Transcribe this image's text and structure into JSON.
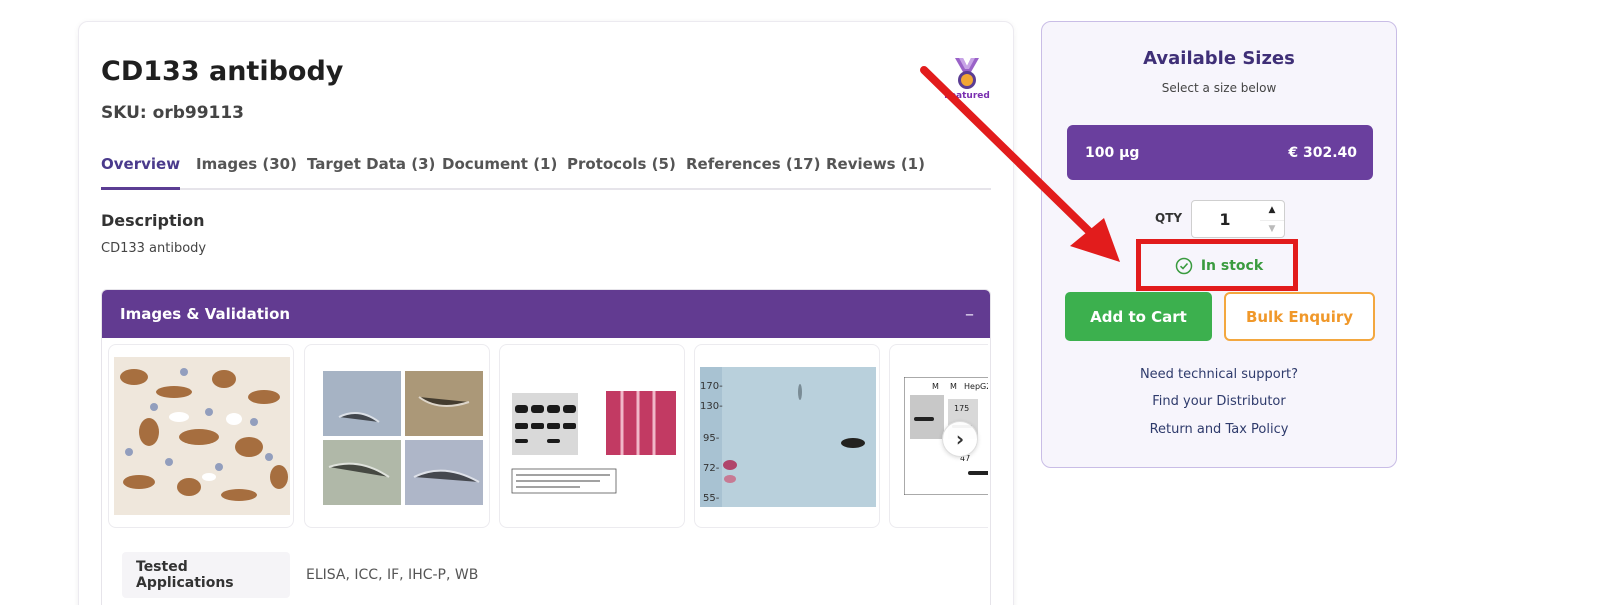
{
  "product": {
    "title": "CD133 antibody",
    "sku": "SKU: orb99113",
    "badge_label": "Featured"
  },
  "tabs": [
    {
      "label": "Overview",
      "active": true
    },
    {
      "label": "Images (30)",
      "active": false
    },
    {
      "label": "Target Data (3)",
      "active": false
    },
    {
      "label": "Document (1)",
      "active": false
    },
    {
      "label": "Protocols (5)",
      "active": false
    },
    {
      "label": "References (17)",
      "active": false
    },
    {
      "label": "Reviews (1)",
      "active": false
    }
  ],
  "description": {
    "heading": "Description",
    "text": "CD133 antibody"
  },
  "images_section": {
    "title": "Images & Validation",
    "toggle": "–",
    "next_icon": "chevron-right-icon"
  },
  "tested_applications": {
    "label": "Tested Applications",
    "value": "ELISA, ICC, IF, IHC-P, WB"
  },
  "sizes": {
    "title": "Available Sizes",
    "subtitle": "Select a size below",
    "option": {
      "size": "100 µg",
      "price": "€ 302.40"
    },
    "qty_label": "QTY",
    "qty_value": "1",
    "stock": "In stock",
    "add_to_cart": "Add to Cart",
    "bulk_enquiry": "Bulk Enquiry",
    "links": [
      "Need technical support?",
      "Find your Distributor",
      "Return and Tax Policy"
    ]
  },
  "colors": {
    "brand_purple": "#623b91",
    "stock_green": "#3a9b3f",
    "cart_green": "#3cb04e",
    "bulk_orange": "#f0982a",
    "annotation_red": "#e21c1c"
  }
}
